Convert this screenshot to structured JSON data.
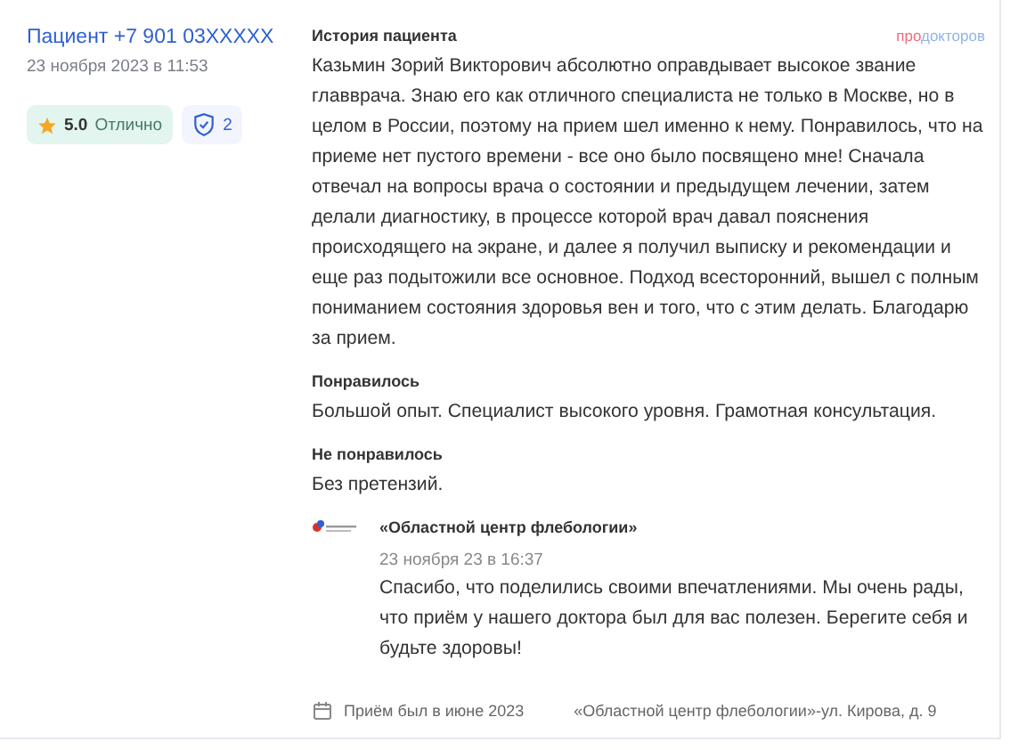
{
  "author": {
    "name": "Пациент +7 901 03XXXXX",
    "date": "23 ноября 2023 в 11:53"
  },
  "rating": {
    "score": "5.0",
    "label": "Отлично"
  },
  "verified": {
    "count": "2"
  },
  "brand": {
    "part_1": "про",
    "part_2": "докторов"
  },
  "sections": [
    {
      "title": "История пациента",
      "text": "Казьмин Зорий Викторович абсолютно оправдывает высокое звание главврача. Знаю его как отличного специалиста не только в Москве, но в целом в России, поэтому на прием шел именно к нему. Понравилось, что на приеме нет пустого времени - все оно было посвящено мне! Сначала отвечал на вопросы врача о состоянии и предыдущем лечении, затем делали диагностику, в процессе которой врач давал пояснения происходящего на экране, и далее я получил выписку и рекомендации и еще раз подытожили все основное. Подход всесторонний, вышел с полным пониманием состояния здоровья вен и того, что с этим делать. Благодарю за прием."
    },
    {
      "title": "Понравилось",
      "text": "Большой опыт. Специалист высокого уровня. Грамотная консультация."
    },
    {
      "title": "Не понравилось",
      "text": "Без претензий."
    }
  ],
  "reply": {
    "clinic": "«Областной центр флебологии»",
    "date": "23 ноября 23 в 16:37",
    "text": "Спасибо, что поделились своими впечатлениями. Мы очень рады, что приём у нашего доктора был для вас полезен. Берегите себя и будьте здоровы!"
  },
  "footer": {
    "visit": "Приём был в июне 2023",
    "address": "«Областной центр флебологии»-ул. Кирова, д. 9"
  }
}
